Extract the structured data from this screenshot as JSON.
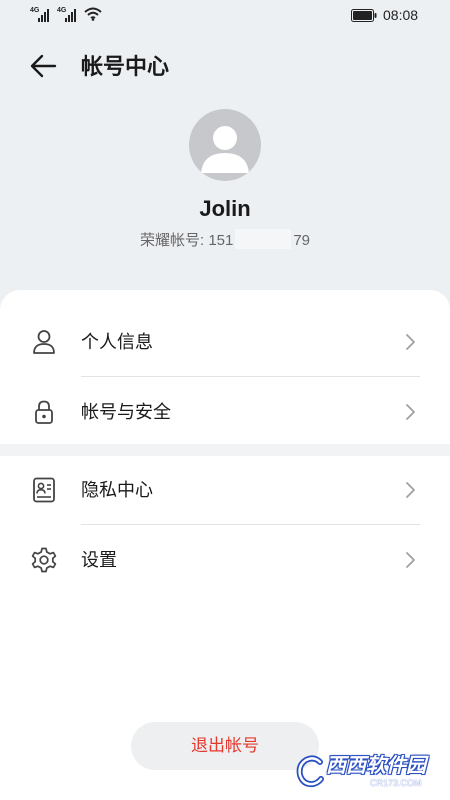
{
  "status_bar": {
    "network_1": "4G",
    "network_2": "4G",
    "time": "08:08"
  },
  "header": {
    "title": "帐号中心"
  },
  "profile": {
    "name": "Jolin",
    "account_label": "荣耀帐号:",
    "account_prefix": "151",
    "account_suffix": "79"
  },
  "menu": {
    "group1": [
      {
        "label": "个人信息",
        "icon": "person-icon"
      },
      {
        "label": "帐号与安全",
        "icon": "lock-icon"
      }
    ],
    "group2": [
      {
        "label": "隐私中心",
        "icon": "id-card-icon"
      },
      {
        "label": "设置",
        "icon": "gear-icon"
      }
    ]
  },
  "logout": {
    "label": "退出帐号"
  },
  "watermark": {
    "main": "西西软件园",
    "sub": "CR173.COM"
  },
  "colors": {
    "header_bg": "#edf0f3",
    "logout_text": "#e5382d",
    "avatar_bg": "#c6c8cb"
  }
}
